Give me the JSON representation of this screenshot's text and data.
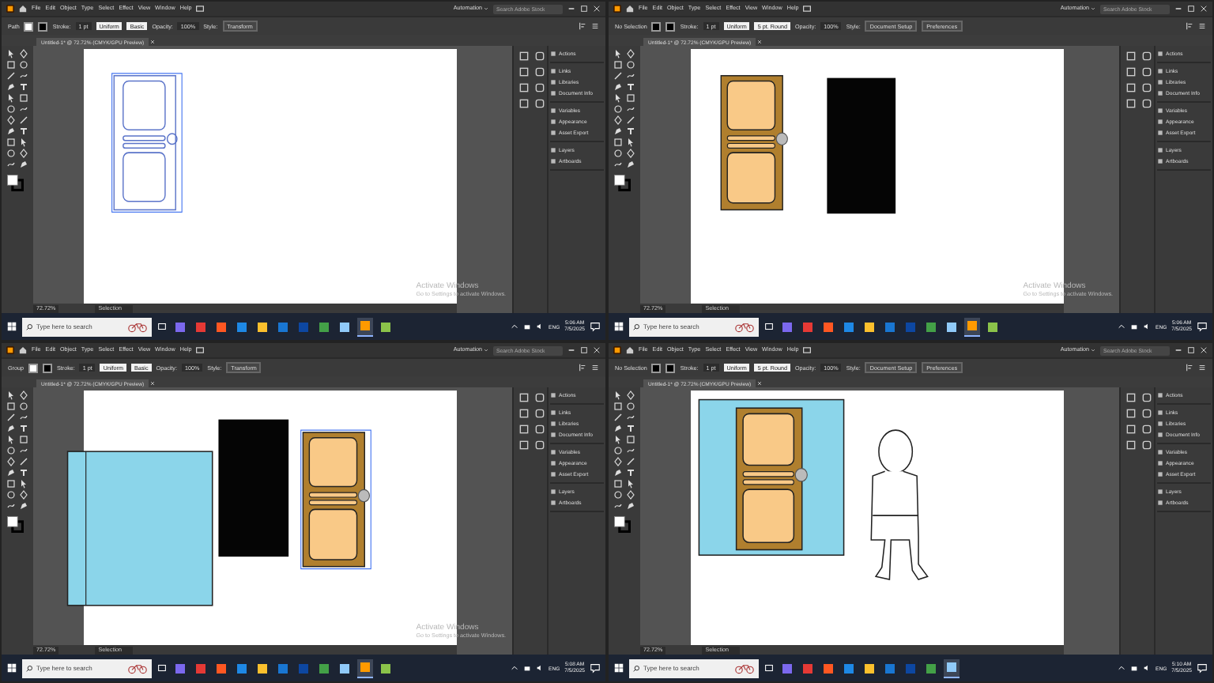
{
  "screens": [
    {
      "menu": [
        "File",
        "Edit",
        "Object",
        "Type",
        "Select",
        "Effect",
        "View",
        "Window",
        "Help"
      ],
      "workspace": "Automation",
      "stock_search": {
        "placeholder": "Search Adobe Stock"
      },
      "control_bar": [
        {
          "kind": "label",
          "text": "Path"
        },
        {
          "kind": "swatch",
          "color": "#ffffff"
        },
        {
          "kind": "swatch",
          "color": "#000000"
        },
        {
          "kind": "label",
          "text": "Stroke:"
        },
        {
          "kind": "field",
          "text": "1 pt"
        },
        {
          "kind": "dropdown",
          "text": "Uniform"
        },
        {
          "kind": "dropdown",
          "text": "Basic"
        },
        {
          "kind": "label",
          "text": "Opacity:"
        },
        {
          "kind": "field",
          "text": "100%"
        },
        {
          "kind": "label",
          "text": "Style:"
        },
        {
          "kind": "button",
          "text": "Transform"
        }
      ],
      "doc_tab": "Untitled-1* @ 72.72% (CMYK/GPU Preview)",
      "artwork": [
        {
          "kind": "door",
          "outline": true,
          "selected": true
        }
      ],
      "panels": [
        "Actions",
        "Links",
        "Libraries",
        "Document Info",
        "Variables",
        "Appearance",
        "Asset Export",
        "Layers",
        "Artboards"
      ],
      "zoom": "72.72%",
      "tool_mode": "Selection",
      "activation": {
        "title": "Activate Windows",
        "hint": "Go to Settings to activate Windows."
      },
      "taskbar": {
        "search": {
          "placeholder": "Type here to search"
        },
        "apps": [
          {
            "selected": false
          },
          {
            "selected": false
          },
          {
            "selected": false
          },
          {
            "selected": false
          },
          {
            "selected": false
          },
          {
            "selected": false
          },
          {
            "selected": false
          },
          {
            "selected": false
          },
          {
            "selected": false
          },
          {
            "selected": true
          },
          {
            "selected": false
          }
        ],
        "language": "ENG",
        "time": "5:06 AM",
        "date": "7/5/2025"
      }
    },
    {
      "menu": [
        "File",
        "Edit",
        "Object",
        "Type",
        "Select",
        "Effect",
        "View",
        "Window",
        "Help"
      ],
      "workspace": "Automation",
      "stock_search": {
        "placeholder": "Search Adobe Stock"
      },
      "control_bar": [
        {
          "kind": "label",
          "text": "No Selection"
        },
        {
          "kind": "swatch",
          "color": "#000000"
        },
        {
          "kind": "swatch",
          "color": "#000000"
        },
        {
          "kind": "label",
          "text": "Stroke:"
        },
        {
          "kind": "field",
          "text": "1 pt"
        },
        {
          "kind": "dropdown",
          "text": "Uniform"
        },
        {
          "kind": "dropdown",
          "text": "5 pt. Round"
        },
        {
          "kind": "label",
          "text": "Opacity:"
        },
        {
          "kind": "field",
          "text": "100%"
        },
        {
          "kind": "label",
          "text": "Style:"
        },
        {
          "kind": "button",
          "text": "Document Setup"
        },
        {
          "kind": "button",
          "text": "Preferences"
        }
      ],
      "doc_tab": "Untitled-1* @ 72.72% (CMYK/GPU Preview)",
      "artwork": [
        {
          "kind": "door",
          "outline": false,
          "selected": false
        },
        {
          "kind": "black-panel"
        }
      ],
      "panels": [
        "Actions",
        "Links",
        "Libraries",
        "Document Info",
        "Variables",
        "Appearance",
        "Asset Export",
        "Layers",
        "Artboards"
      ],
      "zoom": "72.72%",
      "tool_mode": "Selection",
      "activation": {
        "title": "Activate Windows",
        "hint": "Go to Settings to activate Windows."
      },
      "taskbar": {
        "search": {
          "placeholder": "Type here to search"
        },
        "apps": [
          {
            "selected": false
          },
          {
            "selected": false
          },
          {
            "selected": false
          },
          {
            "selected": false
          },
          {
            "selected": false
          },
          {
            "selected": false
          },
          {
            "selected": false
          },
          {
            "selected": false
          },
          {
            "selected": false
          },
          {
            "selected": true
          },
          {
            "selected": false
          }
        ],
        "language": "ENG",
        "time": "5:06 AM",
        "date": "7/5/2025"
      }
    },
    {
      "menu": [
        "File",
        "Edit",
        "Object",
        "Type",
        "Select",
        "Effect",
        "View",
        "Window",
        "Help"
      ],
      "workspace": "Automation",
      "stock_search": {
        "placeholder": "Search Adobe Stock"
      },
      "control_bar": [
        {
          "kind": "label",
          "text": "Group"
        },
        {
          "kind": "swatch",
          "color": "#ffffff"
        },
        {
          "kind": "swatch",
          "color": "#000000"
        },
        {
          "kind": "label",
          "text": "Stroke:"
        },
        {
          "kind": "field",
          "text": "1 pt"
        },
        {
          "kind": "dropdown",
          "text": "Uniform"
        },
        {
          "kind": "dropdown",
          "text": "Basic"
        },
        {
          "kind": "label",
          "text": "Opacity:"
        },
        {
          "kind": "field",
          "text": "100%"
        },
        {
          "kind": "label",
          "text": "Style:"
        },
        {
          "kind": "button",
          "text": "Transform"
        }
      ],
      "doc_tab": "Untitled-1* @ 72.72% (CMYK/GPU Preview)",
      "artwork": [
        {
          "kind": "blue-panel"
        },
        {
          "kind": "black-panel"
        },
        {
          "kind": "door",
          "outline": false,
          "selected": true
        }
      ],
      "panels": [
        "Actions",
        "Links",
        "Libraries",
        "Document Info",
        "Variables",
        "Appearance",
        "Asset Export",
        "Layers",
        "Artboards"
      ],
      "zoom": "72.72%",
      "tool_mode": "Selection",
      "activation": {
        "title": "Activate Windows",
        "hint": "Go to Settings to activate Windows."
      },
      "taskbar": {
        "search": {
          "placeholder": "Type here to search"
        },
        "apps": [
          {
            "selected": false
          },
          {
            "selected": false
          },
          {
            "selected": false
          },
          {
            "selected": false
          },
          {
            "selected": false
          },
          {
            "selected": false
          },
          {
            "selected": false
          },
          {
            "selected": false
          },
          {
            "selected": false
          },
          {
            "selected": true
          },
          {
            "selected": false
          }
        ],
        "language": "ENG",
        "time": "5:08 AM",
        "date": "7/5/2025"
      }
    },
    {
      "menu": [
        "File",
        "Edit",
        "Object",
        "Type",
        "Select",
        "Effect",
        "View",
        "Window",
        "Help"
      ],
      "workspace": "Automation",
      "stock_search": {
        "placeholder": "Search Adobe Stock"
      },
      "control_bar": [
        {
          "kind": "label",
          "text": "No Selection"
        },
        {
          "kind": "swatch",
          "color": "#000000"
        },
        {
          "kind": "swatch",
          "color": "#000000"
        },
        {
          "kind": "label",
          "text": "Stroke:"
        },
        {
          "kind": "field",
          "text": "1 pt"
        },
        {
          "kind": "dropdown",
          "text": "Uniform"
        },
        {
          "kind": "dropdown",
          "text": "5 pt. Round"
        },
        {
          "kind": "label",
          "text": "Opacity:"
        },
        {
          "kind": "field",
          "text": "100%"
        },
        {
          "kind": "label",
          "text": "Style:"
        },
        {
          "kind": "button",
          "text": "Document Setup"
        },
        {
          "kind": "button",
          "text": "Preferences"
        }
      ],
      "doc_tab": "Untitled-1* @ 72.72% (CMYK/GPU Preview)",
      "artwork": [
        {
          "kind": "blue-panel"
        },
        {
          "kind": "door",
          "outline": false,
          "selected": false
        },
        {
          "kind": "figure"
        }
      ],
      "panels": [
        "Actions",
        "Links",
        "Libraries",
        "Document Info",
        "Variables",
        "Appearance",
        "Asset Export",
        "Layers",
        "Artboards"
      ],
      "zoom": "72.72%",
      "tool_mode": "Selection",
      "taskbar": {
        "search": {
          "placeholder": "Type here to search"
        },
        "apps": [
          {
            "selected": false
          },
          {
            "selected": false
          },
          {
            "selected": false
          },
          {
            "selected": false
          },
          {
            "selected": false
          },
          {
            "selected": false
          },
          {
            "selected": false
          },
          {
            "selected": false
          },
          {
            "selected": true
          }
        ],
        "language": "ENG",
        "time": "5:10 AM",
        "date": "7/5/2025"
      }
    }
  ]
}
